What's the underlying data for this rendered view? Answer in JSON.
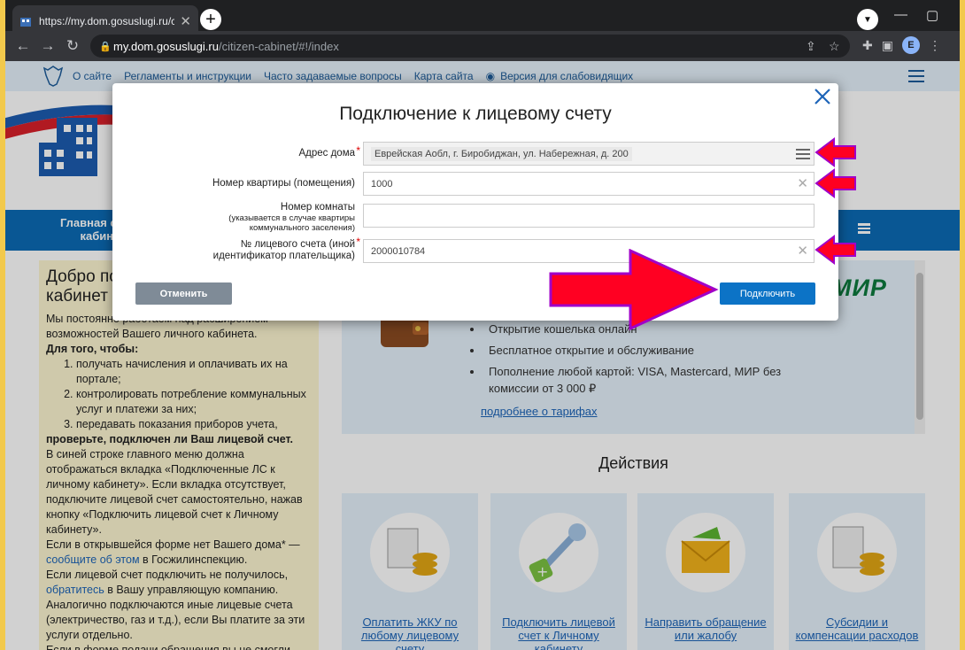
{
  "browser": {
    "tab_title": "https://my.dom.gosuslugi.ru/citiz",
    "url_domain": "my.dom.gosuslugi.ru",
    "url_path": "/citizen-cabinet/#!/index",
    "profile_initial": "E"
  },
  "topnav": {
    "links": [
      "О сайте",
      "Регламенты и инструкции",
      "Часто задаваемые вопросы",
      "Карта сайта",
      "Версия для слабовидящих"
    ]
  },
  "bluenav": {
    "item": "Главная стра... кабинет"
  },
  "sidebar": {
    "title": "Добро пожаловать в личный кабинет",
    "p1": "Мы постоянно работаем над расширением возможностей Вашего личного кабинета.",
    "p2": "Для того, чтобы:",
    "list": [
      "получать начисления и оплачивать их на портале;",
      "контролировать потребление коммунальных услуг и платежи за них;",
      "передавать показания приборов учета,"
    ],
    "p3": "проверьте, подключен ли Ваш лицевой счет.",
    "p4": "В синей строке главного меню должна отображаться вкладка «Подключенные ЛС к личному кабинету». Если вкладка отсутствует, подключите лицевой счет самостоятельно, нажав кнопку «Подключить лицевой счет к Личному кабинету».",
    "p5a": "Если в открывшейся форме нет Вашего дома* —",
    "p5link": "сообщите об этом",
    "p5b": " в Госжилинспекцию.",
    "p6a": "Если лицевой счет подключить не получилось, ",
    "p6link": "обратитесь",
    "p6b": " в Вашу управляющую компанию.",
    "p7": "Аналогично подключаются иные лицевые счета (электричество, газ и т.д.), если Вы платите за эти услуги отдельно.",
    "p8": "Если в форме подачи обращения вы не смогли"
  },
  "promo": {
    "brand": "МИР",
    "bullets": [
      "Открытие кошелька онлайн",
      "Бесплатное открытие и обслуживание",
      "Пополнение любой картой: VISA, Mastercard, МИР без комиссии от 3 000 ₽"
    ],
    "more_link": "подробнее о тарифах"
  },
  "actions": {
    "title": "Действия",
    "cards": [
      {
        "label": "Оплатить ЖКУ по любому лицевому счету"
      },
      {
        "label": "Подключить лицевой счет к Личному кабинету"
      },
      {
        "label": "Направить обращение или жалобу"
      },
      {
        "label": "Субсидии и компенсации расходов"
      }
    ]
  },
  "modal": {
    "title": "Подключение к лицевому счету",
    "fields": [
      {
        "label": "Адрес дома",
        "sub": "",
        "value": "Еврейская Аобл, г. Биробиджан, ул. Набережная, д. 200",
        "required": "*"
      },
      {
        "label": "Номер квартиры (помещения)",
        "sub": "",
        "value": "1000",
        "required": ""
      },
      {
        "label": "Номер комнаты",
        "sub": "(указывается в случае квартиры коммунального заселения)",
        "value": "",
        "required": ""
      },
      {
        "label": "№ лицевого счета (иной идентификатор плательщика)",
        "sub": "",
        "value": "2000010784",
        "required": "*"
      }
    ],
    "cancel_label": "Отменить",
    "submit_label": "Подключить"
  },
  "colors": {
    "accent": "#0c73c6",
    "annotation": "#ff0022",
    "annotation_outline": "#a000c8"
  }
}
